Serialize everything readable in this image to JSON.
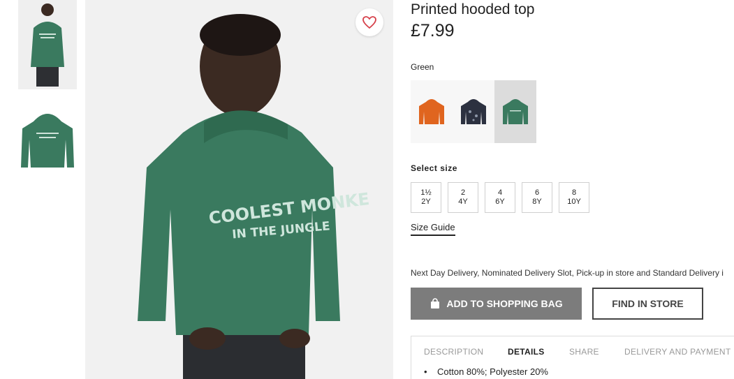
{
  "gallery": {
    "thumbnails": [
      "model-photo",
      "flat-photo"
    ],
    "main_image_print": [
      "COOLEST MONKE",
      "IN THE JUNGLE"
    ]
  },
  "product": {
    "title": "Printed hooded top",
    "price": "£7.99",
    "color_name": "Green",
    "swatches": [
      {
        "name": "orange",
        "hex": "#e0651f",
        "selected": false
      },
      {
        "name": "navy-print",
        "hex": "#2c3140",
        "selected": false
      },
      {
        "name": "green",
        "hex": "#3a7a5f",
        "selected": true
      }
    ],
    "select_size_label": "Select size",
    "sizes": [
      {
        "top": "1½",
        "bottom": "2Y"
      },
      {
        "top": "2",
        "bottom": "4Y"
      },
      {
        "top": "4",
        "bottom": "6Y"
      },
      {
        "top": "6",
        "bottom": "8Y"
      },
      {
        "top": "8",
        "bottom": "10Y"
      }
    ],
    "size_guide": "Size Guide",
    "delivery_text": "Next Day Delivery, Nominated Delivery Slot, Pick-up in store and Standard Delivery i",
    "add_to_bag": "ADD TO SHOPPING BAG",
    "find_in_store": "FIND IN STORE"
  },
  "tabs": [
    {
      "label": "DESCRIPTION",
      "active": false
    },
    {
      "label": "DETAILS",
      "active": true
    },
    {
      "label": "SHARE",
      "active": false
    },
    {
      "label": "DELIVERY AND PAYMENT",
      "active": false
    }
  ],
  "details": {
    "bullet": "•",
    "item": "Cotton 80%; Polyester 20%"
  },
  "colors": {
    "hoodie_green": "#3a7a5f",
    "bag_button": "#7c7c7c",
    "heart": "#d6404a"
  }
}
